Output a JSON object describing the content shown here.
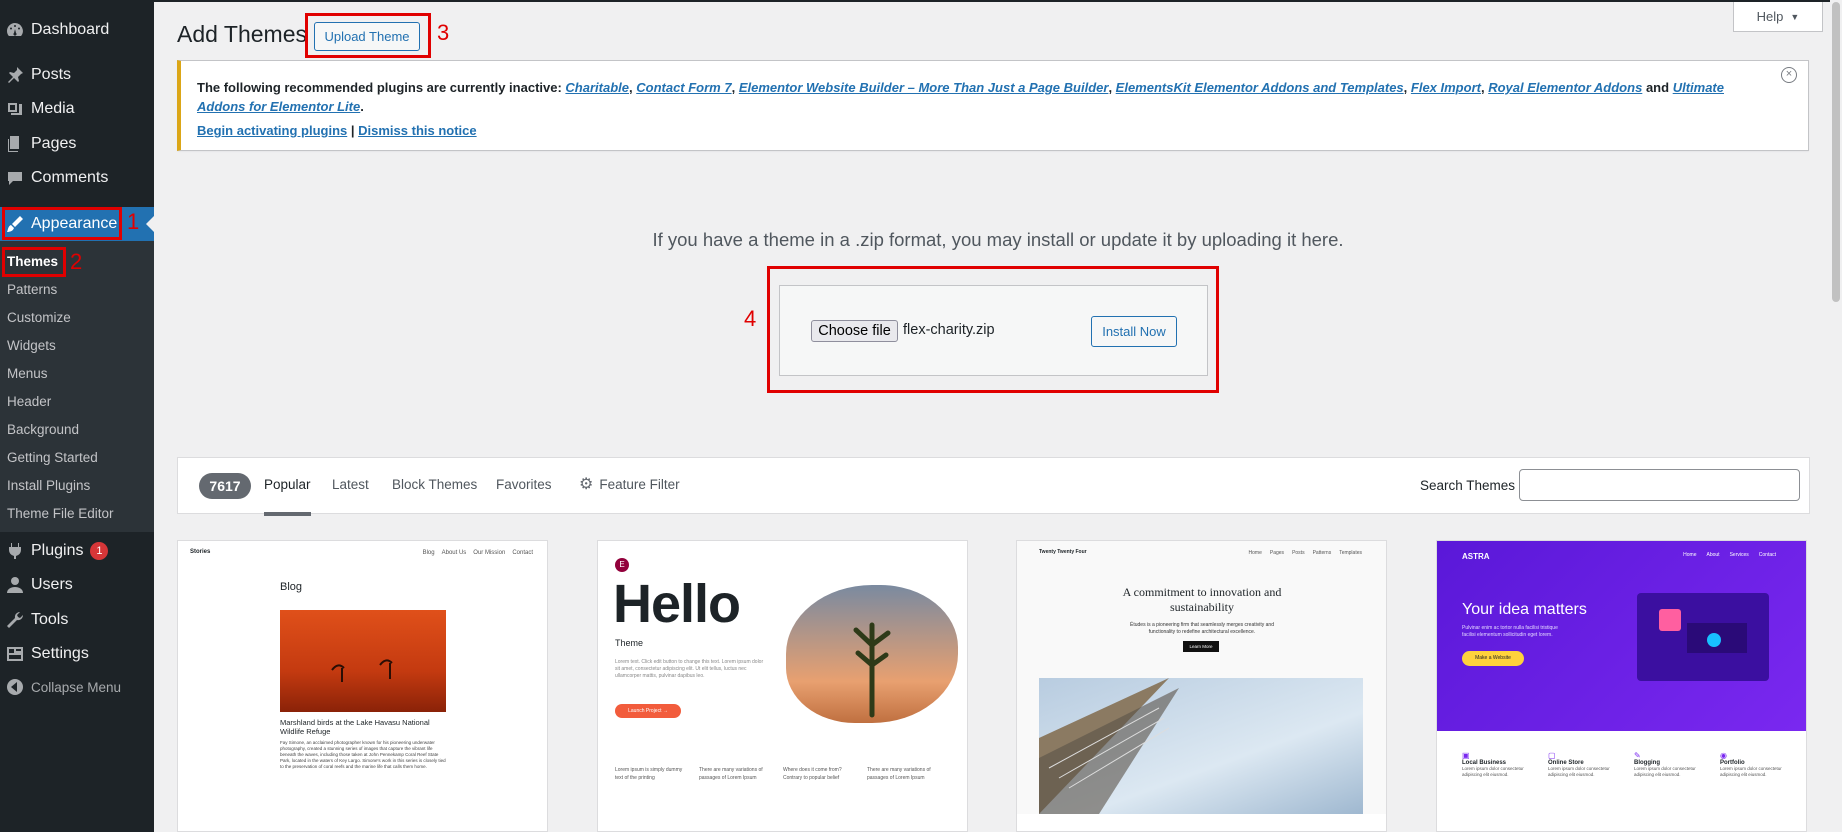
{
  "sidebar": {
    "items": [
      {
        "label": "Dashboard",
        "icon": "dashboard-icon"
      },
      {
        "label": "Posts",
        "icon": "pin-icon"
      },
      {
        "label": "Media",
        "icon": "media-icon"
      },
      {
        "label": "Pages",
        "icon": "pages-icon"
      },
      {
        "label": "Comments",
        "icon": "comment-icon"
      },
      {
        "label": "Appearance",
        "icon": "brush-icon"
      },
      {
        "label": "Plugins",
        "icon": "plugin-icon",
        "badge": "1"
      },
      {
        "label": "Users",
        "icon": "user-icon"
      },
      {
        "label": "Tools",
        "icon": "wrench-icon"
      },
      {
        "label": "Settings",
        "icon": "settings-icon"
      },
      {
        "label": "Collapse Menu",
        "icon": "collapse-icon"
      }
    ],
    "submenu": [
      "Themes",
      "Patterns",
      "Customize",
      "Widgets",
      "Menus",
      "Header",
      "Background",
      "Getting Started",
      "Install Plugins",
      "Theme File Editor"
    ]
  },
  "annotations": [
    "1",
    "2",
    "3",
    "4"
  ],
  "header": {
    "title": "Add Themes",
    "upload_label": "Upload Theme",
    "help_label": "Help"
  },
  "notice": {
    "intro": "The following recommended plugins are currently inactive:",
    "plugins": [
      "Charitable",
      "Contact Form 7",
      "Elementor Website Builder – More Than Just a Page Builder",
      "ElementsKit Elementor Addons and Templates",
      "Flex Import",
      "Royal Elementor Addons",
      "Ultimate Addons for Elementor Lite"
    ],
    "and_word": "and",
    "begin_label": "Begin activating plugins",
    "separator": "|",
    "dismiss_label": "Dismiss this notice"
  },
  "upload": {
    "message": "If you have a theme in a .zip format, you may install or update it by uploading it here.",
    "choose_label": "Choose file",
    "file_name": "flex-charity.zip",
    "install_label": "Install Now"
  },
  "filters": {
    "count": "7617",
    "tabs": [
      "Popular",
      "Latest",
      "Block Themes",
      "Favorites"
    ],
    "feature_filter": "Feature Filter",
    "search_label": "Search Themes",
    "search_value": ""
  },
  "themes": {
    "stories": {
      "brand": "Stories",
      "nav": [
        "Blog",
        "About Us",
        "Our Mission",
        "Contact"
      ],
      "heading": "Blog",
      "post_title": "Marshland birds at the Lake Havasu National Wildlife Refuge",
      "body": "Fay Simone, an acclaimed photographer known for his pioneering underwater photography, created a stunning series of images that capture the vibrant life beneath the waves, including those taken at John Pennekamp Coral Reef State Park, located in the waters of Key Largo. Simone's work in this series is closely tied to the preservation of coral reefs and the marine life that calls them home."
    },
    "hello": {
      "logo": "E",
      "title": "Hello",
      "subtitle": "Theme",
      "body": "Lorem text. Click edit button to change this text. Lorem ipsum dolor sit amet, consectetur adipiscing elit. Ut elit tellus, luctus nec ullamcorper mattis, pulvinar dapibus leo.",
      "cta": "Launch Project →",
      "features": [
        "Lorem ipsum is simply dummy text of the printing",
        "There are many variations of passages of Lorem Ipsum",
        "Where does it come from? Contrary to popular belief",
        "There are many variations of passages of Lorem Ipsum"
      ]
    },
    "twentyfour": {
      "brand": "Twenty Twenty Four",
      "nav": [
        "Home",
        "Pages",
        "Posts",
        "Patterns",
        "Templates"
      ],
      "headline": "A commitment to innovation and sustainability",
      "sub": "Études is a pioneering firm that seamlessly merges creativity and functionality to redefine architectural excellence.",
      "cta": "Learn More"
    },
    "astra": {
      "brand": "ASTRA",
      "nav": [
        "Home",
        "About",
        "Services",
        "Contact"
      ],
      "headline": "Your idea matters",
      "sub": "Pulvinar enim ac tortor nulla facilisi tristique facilisi elementum sollicitudin eget lorem.",
      "cta": "Make a Website",
      "features": [
        {
          "title": "Local Business",
          "text": "Lorem ipsum dolor consectetur adipiscing elit eiusmod."
        },
        {
          "title": "Online Store",
          "text": "Lorem ipsum dolor consectetur adipiscing elit eiusmod."
        },
        {
          "title": "Blogging",
          "text": "Lorem ipsum dolor consectetur adipiscing elit eiusmod."
        },
        {
          "title": "Portfolio",
          "text": "Lorem ipsum dolor consectetur adipiscing elit eiusmod."
        }
      ]
    }
  },
  "colors": {
    "sidebar_bg": "#1d2327",
    "accent": "#2271b1",
    "annotation": "#e00000",
    "notice_border": "#dba617",
    "astra_purple": "#6b1fe0"
  }
}
